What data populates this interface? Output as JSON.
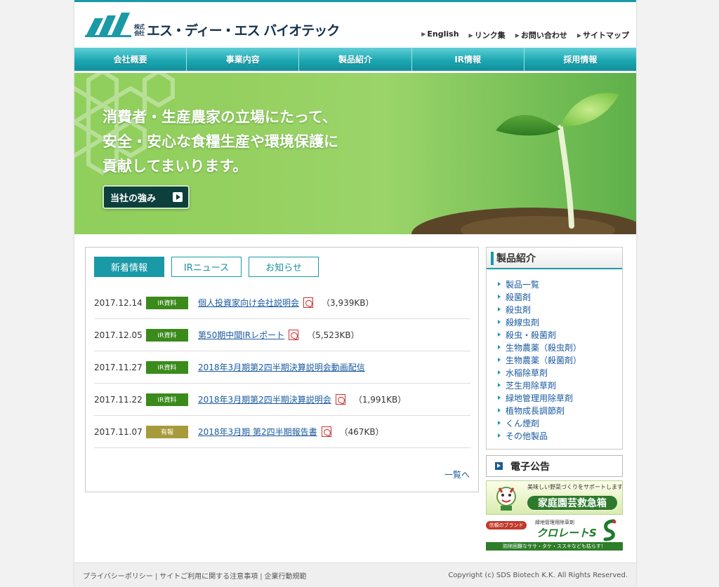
{
  "header": {
    "logo_kaisha": "株式会社",
    "logo_name": "エス・ディー・エス バイオテック",
    "logo_mark_text": "SDS Biotech",
    "util_links": [
      "English",
      "リンク集",
      "お問い合わせ",
      "サイトマップ"
    ]
  },
  "nav": [
    "会社概要",
    "事業内容",
    "製品紹介",
    "IR情報",
    "採用情報"
  ],
  "hero": {
    "lines": [
      "消費者・生産農家の立場にたって、",
      "安全・安心な食糧生産や環境保護に",
      "貢献してまいります。"
    ],
    "button": "当社の強み"
  },
  "news": {
    "tabs": [
      "新着情報",
      "IRニュース",
      "お知らせ"
    ],
    "active_tab": 0,
    "items": [
      {
        "date": "2017.12.14",
        "badge": "IR資料",
        "badge_color": "#3a8a1c",
        "title": "個人投資家向け会社説明会",
        "pdf": true,
        "size": "（3,939KB）"
      },
      {
        "date": "2017.12.05",
        "badge": "IR資料",
        "badge_color": "#3a8a1c",
        "title": "第50期中間IRレポート",
        "pdf": true,
        "size": "（5,523KB）"
      },
      {
        "date": "2017.11.27",
        "badge": "IR資料",
        "badge_color": "#3a8a1c",
        "title": "2018年3月期第2四半期決算説明会動画配信",
        "pdf": false,
        "size": ""
      },
      {
        "date": "2017.11.22",
        "badge": "IR資料",
        "badge_color": "#3a8a1c",
        "title": "2018年3月期第2四半期決算説明会",
        "pdf": true,
        "size": "（1,991KB）"
      },
      {
        "date": "2017.11.07",
        "badge": "有報",
        "badge_color": "#a79a3a",
        "title": "2018年3月期 第2四半期報告書",
        "pdf": true,
        "size": "（467KB）"
      }
    ],
    "more": "一覧へ"
  },
  "products": {
    "heading": "製品紹介",
    "items": [
      "製品一覧",
      "殺菌剤",
      "殺虫剤",
      "殺線虫剤",
      "殺虫・殺菌剤",
      "生物農薬（殺虫剤）",
      "生物農薬（殺菌剤）",
      "水稲除草剤",
      "芝生用除草剤",
      "緑地管理用除草剤",
      "植物成長調節剤",
      "くん煙剤",
      "その他製品"
    ]
  },
  "koukoku": "電子公告",
  "banner1": {
    "sub": "美味しい野菜づくりをサポートします",
    "main": "家庭園芸救急箱"
  },
  "banner2": {
    "tag": "信頼のブランド",
    "small": "緑地管理用除草剤",
    "brand": "クロレートS",
    "foot": "防除困難なササ・タケ・ススキなども枯らす！"
  },
  "footer": {
    "links": [
      "プライバシーポリシー",
      "サイトご利用に関する注意事項",
      "企業行動規範"
    ],
    "copyright": "Copyright (c) SDS Biotech K.K. All Rights Reserved."
  },
  "colors": {
    "accent": "#1a9aa6",
    "link": "#1a5aa0",
    "badge_ir": "#3a8a1c",
    "badge_yuho": "#a79a3a"
  }
}
